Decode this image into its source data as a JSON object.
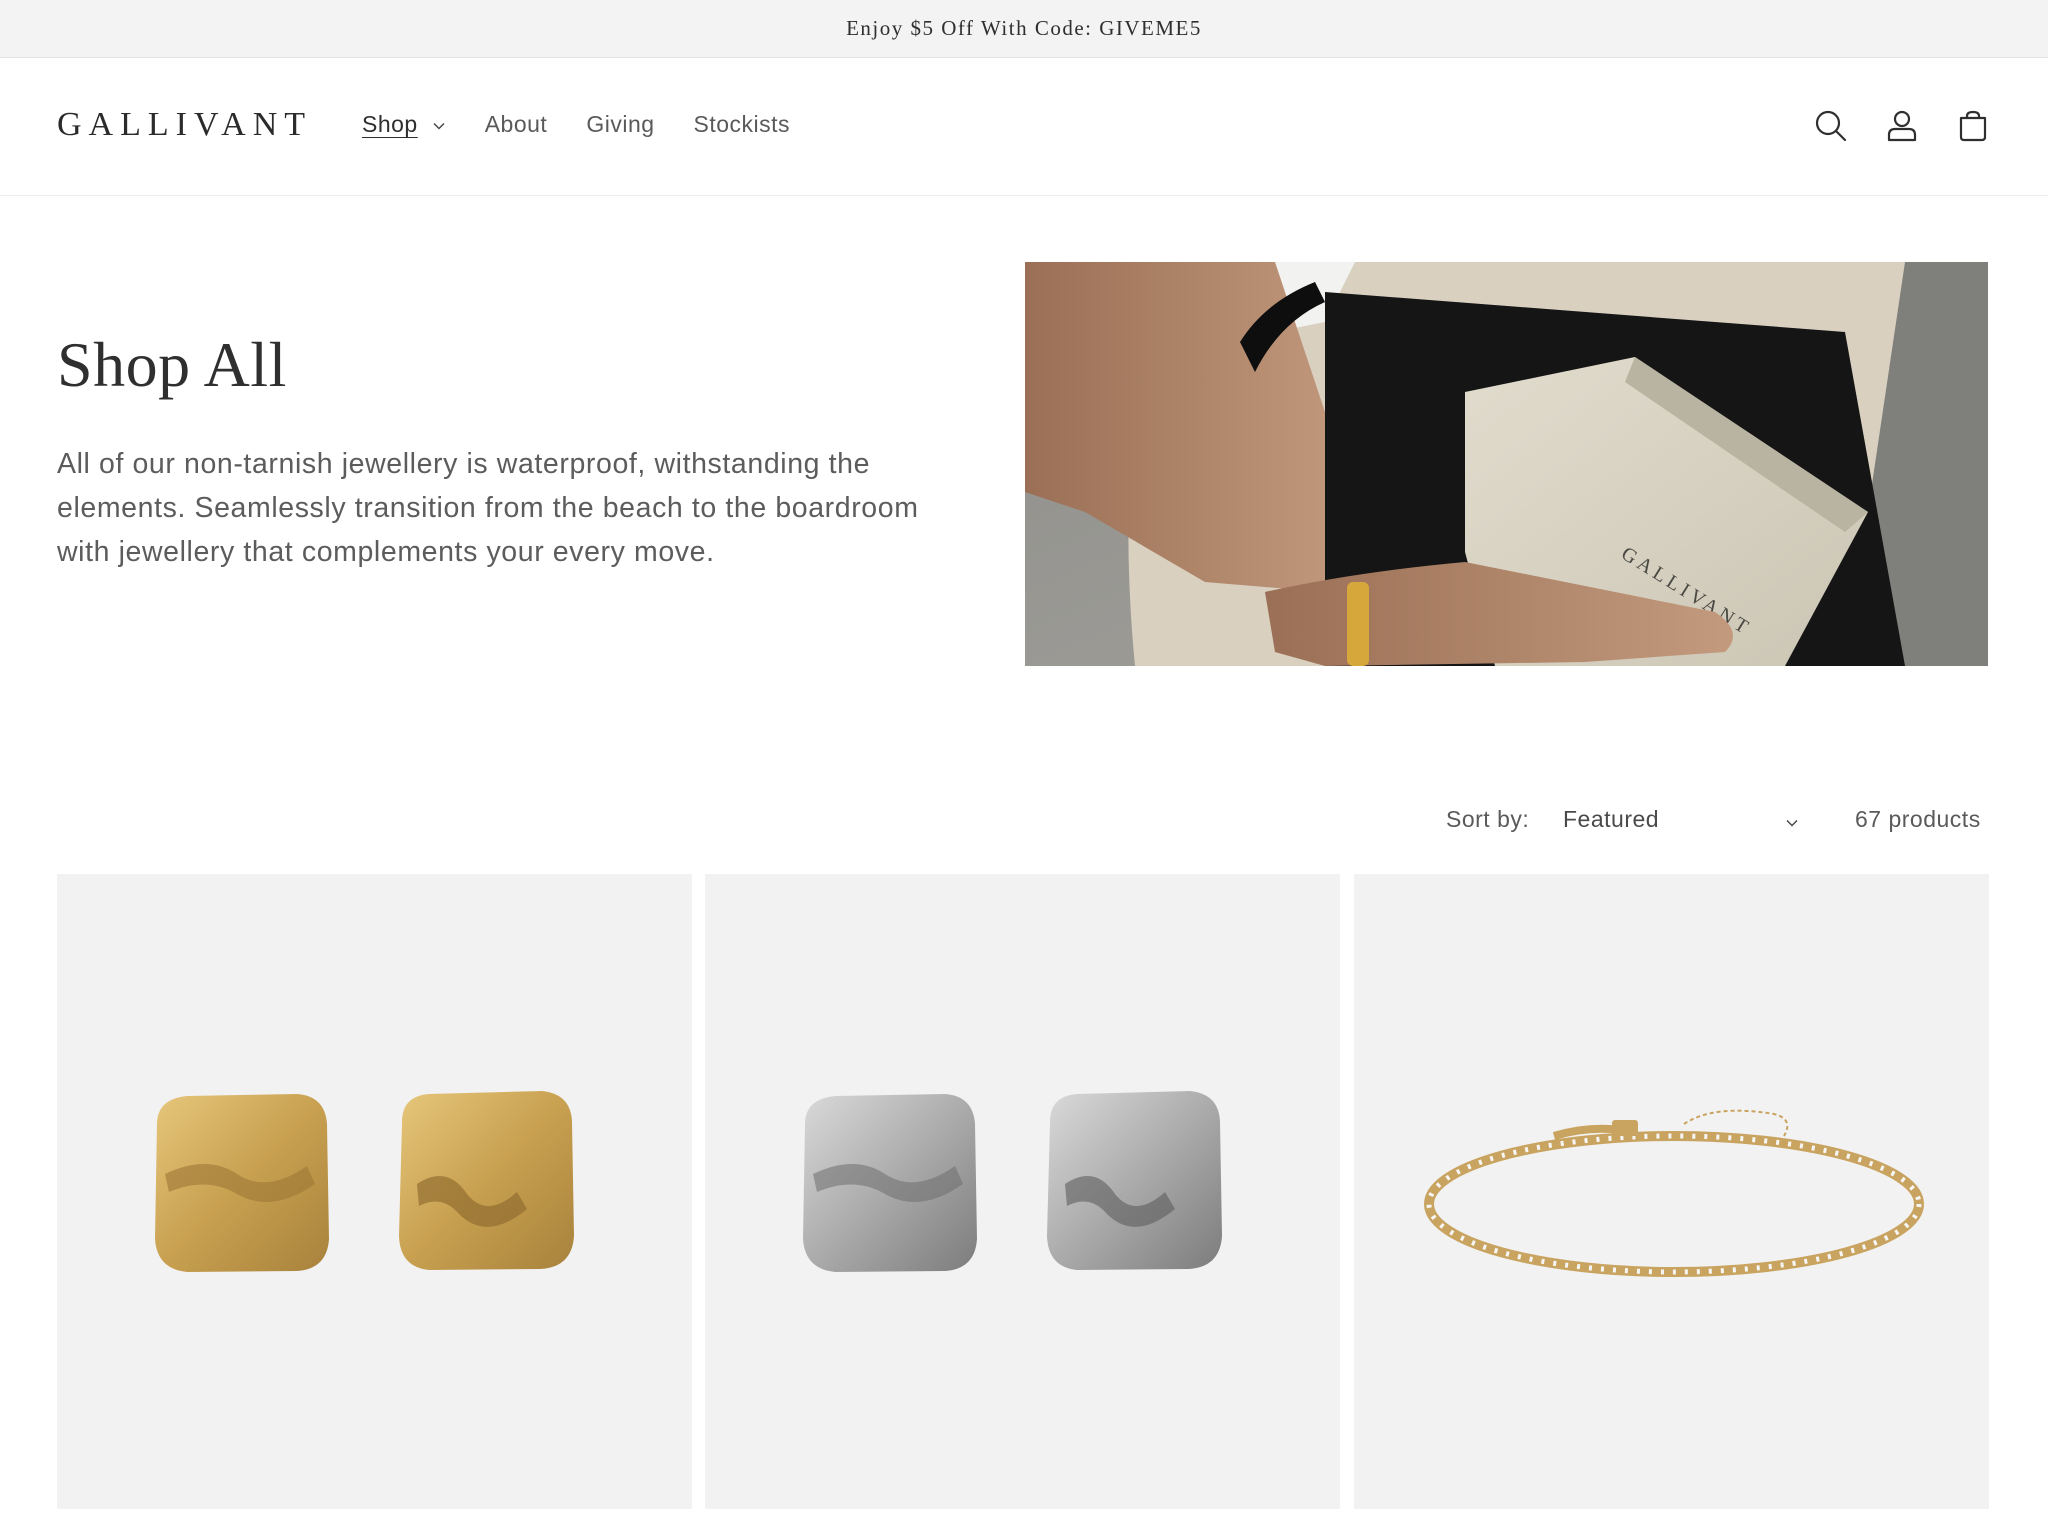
{
  "announcement": {
    "text": "Enjoy $5 Off With Code: GIVEME5"
  },
  "header": {
    "logo": "GALLIVANT",
    "nav": [
      {
        "label": "Shop",
        "active": true,
        "has_dropdown": true
      },
      {
        "label": "About"
      },
      {
        "label": "Giving"
      },
      {
        "label": "Stockists"
      }
    ],
    "icons": [
      "search-icon",
      "account-icon",
      "cart-icon"
    ]
  },
  "hero": {
    "title": "Shop All",
    "description": "All of our non-tarnish jewellery is waterproof, withstanding the elements. Seamlessly transition from the beach to the boardroom with jewellery that complements your every move.",
    "image_box_text": "GALLIVANT"
  },
  "toolbar": {
    "sort_label": "Sort by:",
    "sort_value": "Featured",
    "product_count": "67 products"
  },
  "products": [
    {
      "image": "gold square earrings",
      "tone": "#c9a45a"
    },
    {
      "image": "silver square earrings",
      "tone": "#a9a9a9"
    },
    {
      "image": "gold tennis bracelet",
      "tone": "#c7a45e"
    }
  ]
}
